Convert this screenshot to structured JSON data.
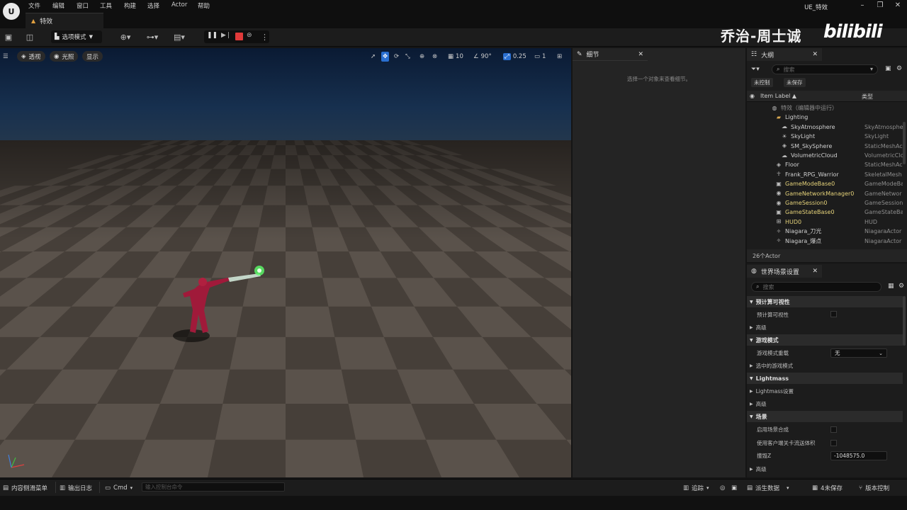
{
  "titlebar": {
    "logo_text": "U",
    "menu": [
      "文件",
      "编辑",
      "窗口",
      "工具",
      "构建",
      "选择",
      "Actor",
      "帮助"
    ],
    "level_tab": "特效",
    "project_name": "UE_特效"
  },
  "toolbar": {
    "mode_label": "选项模式"
  },
  "watermark": {
    "name": "乔治-周士诚",
    "logo": "bilibili"
  },
  "viewport": {
    "perspective_label": "透视",
    "lit_label": "光照",
    "show_label": "显示",
    "grid_value": "10",
    "angle_value": "90°",
    "scale_value": "0.25",
    "camera_value": "1"
  },
  "details": {
    "tab_label": "细节",
    "hint": "选择一个对象来查看细节。"
  },
  "outliner": {
    "tab_label": "大纲",
    "search_placeholder": "搜索",
    "chip_unsaved": "未控制",
    "chip_unsaved2": "未保存",
    "col_label": "Item Label ▲",
    "col_type": "类型",
    "rows": [
      {
        "label": "特效（编辑器中运行）",
        "type": "",
        "indent": 34,
        "icon": "world-icon",
        "color": "#8a8a8a"
      },
      {
        "label": "Lighting",
        "type": "",
        "indent": 40,
        "icon": "folder-icon",
        "color": "#d0d0d0"
      },
      {
        "label": "SkyAtmosphere",
        "type": "SkyAtmosphe",
        "indent": 48,
        "icon": "sky-atmosphere-icon",
        "color": "#d0d0d0"
      },
      {
        "label": "SkyLight",
        "type": "SkyLight",
        "indent": 48,
        "icon": "skylight-icon",
        "color": "#d0d0d0"
      },
      {
        "label": "SM_SkySphere",
        "type": "StaticMeshAc",
        "indent": 48,
        "icon": "mesh-icon",
        "color": "#d0d0d0"
      },
      {
        "label": "VolumetricCloud",
        "type": "VolumetricClo",
        "indent": 48,
        "icon": "cloud-icon",
        "color": "#d0d0d0"
      },
      {
        "label": "Floor",
        "type": "StaticMeshAc",
        "indent": 40,
        "icon": "mesh-icon",
        "color": "#d0d0d0"
      },
      {
        "label": "Frank_RPG_Warrior",
        "type": "SkeletalMesh",
        "indent": 40,
        "icon": "skeletal-icon",
        "color": "#d0d0d0"
      },
      {
        "label": "GameModeBase0",
        "type": "GameModeBa",
        "indent": 40,
        "icon": "gamemode-icon",
        "color": "#e5d27a"
      },
      {
        "label": "GameNetworkManager0",
        "type": "GameNetwor",
        "indent": 40,
        "icon": "network-icon",
        "color": "#e5d27a"
      },
      {
        "label": "GameSession0",
        "type": "GameSession",
        "indent": 40,
        "icon": "session-icon",
        "color": "#e5d27a"
      },
      {
        "label": "GameStateBase0",
        "type": "GameStateBa",
        "indent": 40,
        "icon": "gamestate-icon",
        "color": "#e5d27a"
      },
      {
        "label": "HUD0",
        "type": "HUD",
        "indent": 40,
        "icon": "hud-icon",
        "color": "#e5d27a"
      },
      {
        "label": "Niagara_刀光",
        "type": "NiagaraActor",
        "indent": 40,
        "icon": "niagara-icon",
        "color": "#d0d0d0"
      },
      {
        "label": "Niagara_爆点",
        "type": "NiagaraActor",
        "indent": 40,
        "icon": "niagara-icon",
        "color": "#d0d0d0"
      }
    ],
    "footer": "26个Actor"
  },
  "world_settings": {
    "tab_label": "世界场景设置",
    "search_placeholder": "搜索",
    "cat_precomputed": "预计算可视性",
    "row_precomputed": "预计算可视性",
    "sub_advanced1": "高级",
    "cat_game_mode": "游戏模式",
    "row_game_mode_override": "游戏模式重载",
    "game_mode_value": "无",
    "sub_selected_game_mode": "选中的游戏模式",
    "cat_lightmass": "Lightmass",
    "sub_lightmass_settings": "Lightmass设置",
    "sub_advanced2": "高级",
    "cat_world": "场景",
    "row_enable_world_composition": "启用场景合成",
    "row_client_side_level_streaming": "使用客户端关卡流送体积",
    "row_kill_z": "撞毁Z",
    "kill_z_value": "-1048575.0",
    "sub_advanced3": "高级"
  },
  "statusbar": {
    "content_drawer": "内容侧滑菜单",
    "output_log": "输出日志",
    "cmd_label": "Cmd",
    "cmd_placeholder": "输入控制台命令",
    "trace": "追踪",
    "derived_data": "派生数据",
    "unsaved": "4未保存",
    "source_control": "版本控制"
  }
}
